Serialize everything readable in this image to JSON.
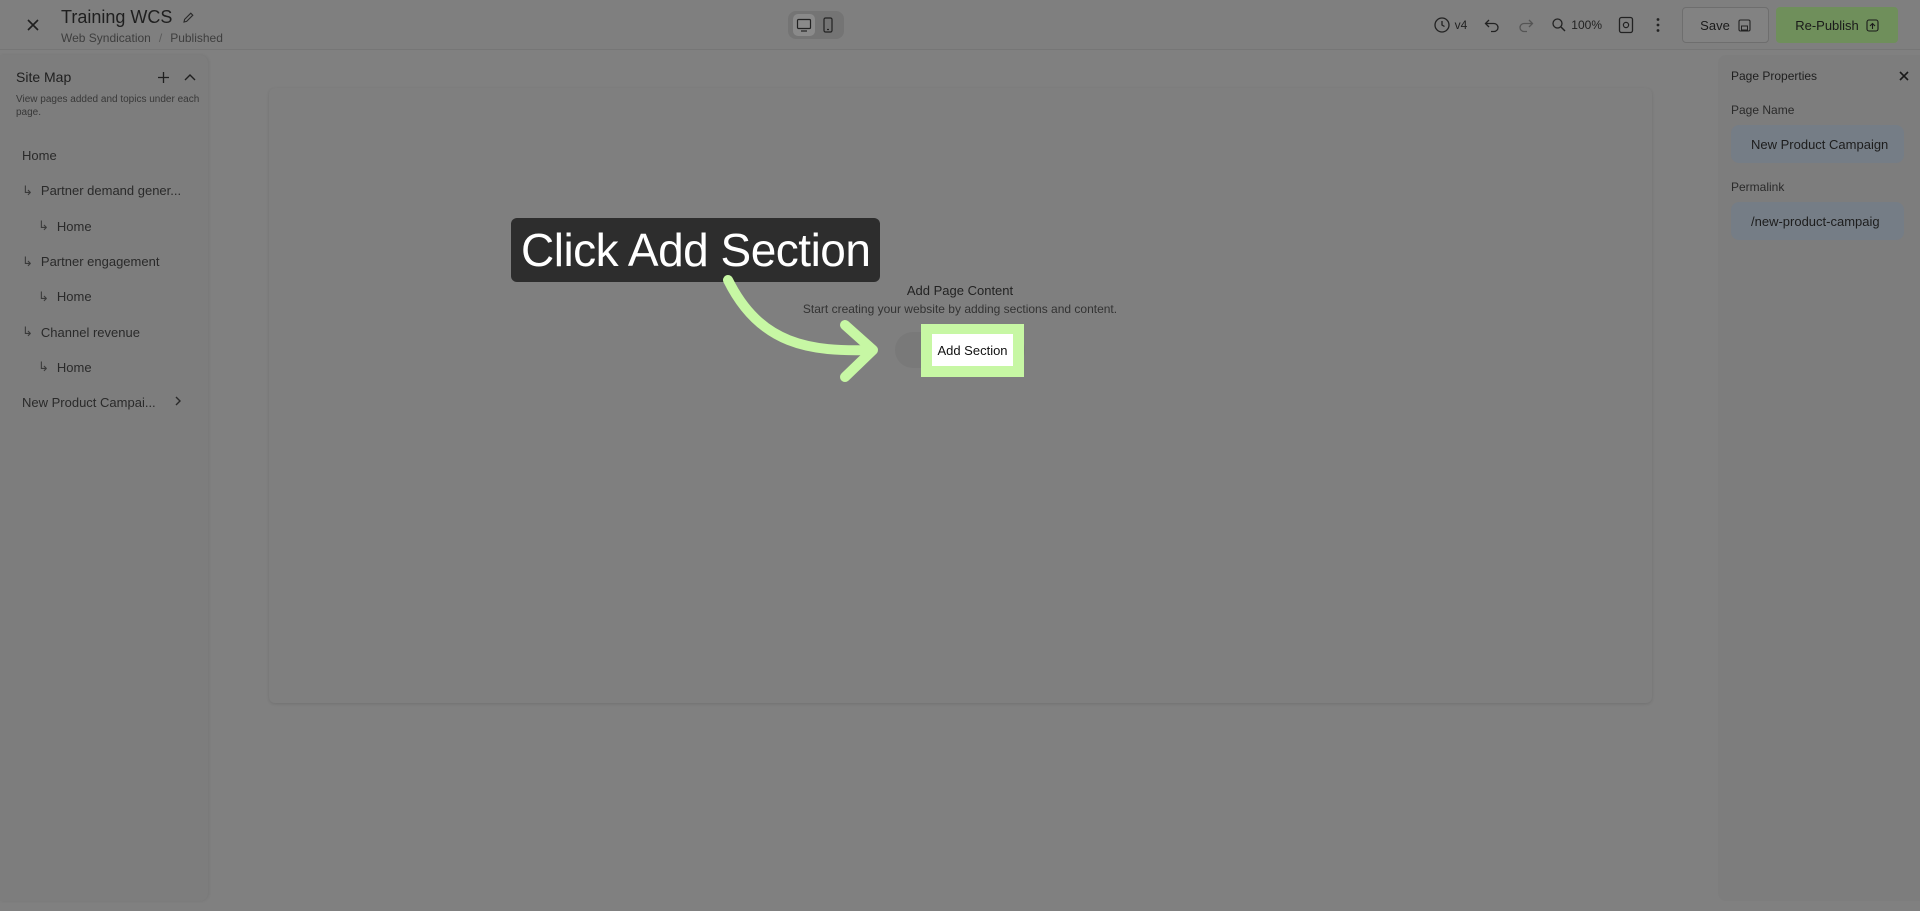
{
  "header": {
    "title": "Training WCS",
    "breadcrumb": [
      "Web Syndication",
      "Published"
    ],
    "version": "v4",
    "zoom": "100%",
    "save_label": "Save",
    "publish_label": "Re-Publish"
  },
  "sidebar": {
    "title": "Site Map",
    "description": "View pages added and topics under each page.",
    "items": [
      {
        "label": "Home"
      },
      {
        "label": "Partner demand gener..."
      },
      {
        "label": "Home"
      },
      {
        "label": "Partner engagement"
      },
      {
        "label": "Home"
      },
      {
        "label": "Channel revenue"
      },
      {
        "label": "Home"
      },
      {
        "label": "New Product Campai..."
      }
    ]
  },
  "canvas": {
    "empty_title": "Add Page Content",
    "empty_subtitle": "Start creating your website by adding sections and content.",
    "add_section_label": "Add Section"
  },
  "properties": {
    "title": "Page Properties",
    "page_name_label": "Page Name",
    "page_name_value": "New Product Campaign",
    "permalink_label": "Permalink",
    "permalink_value": "/new-product-campaig"
  },
  "tutorial": {
    "callout": "Click Add Section",
    "highlight_color": "#c7f7a4"
  },
  "colors": {
    "publish_bg": "#6f8f5b",
    "callout_bg": "#2d2d2d"
  }
}
